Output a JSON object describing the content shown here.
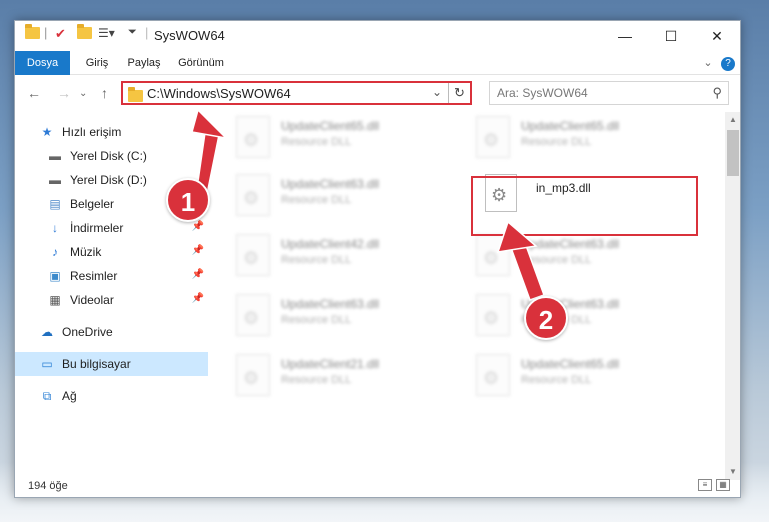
{
  "window": {
    "title": "SysWOW64",
    "minimize_glyph": "—",
    "maximize_glyph": "☐",
    "close_glyph": "✕"
  },
  "ribbon": {
    "tabs": [
      "Dosya",
      "Giriş",
      "Paylaş",
      "Görünüm"
    ],
    "expand_glyph": "⌄",
    "help_glyph": "?"
  },
  "address": {
    "path": "C:\\Windows\\SysWOW64",
    "search_placeholder": "Ara: SysWOW64"
  },
  "sidebar": {
    "items": [
      {
        "label": "Hızlı erişim",
        "icon": "star-icon",
        "pinned": false
      },
      {
        "label": "Yerel Disk (C:)",
        "icon": "drive-icon",
        "pinned": false
      },
      {
        "label": "Yerel Disk (D:)",
        "icon": "drive-icon",
        "pinned": false
      },
      {
        "label": "Belgeler",
        "icon": "documents-icon",
        "pinned": true
      },
      {
        "label": "İndirmeler",
        "icon": "download-icon",
        "pinned": true
      },
      {
        "label": "Müzik",
        "icon": "music-icon",
        "pinned": true
      },
      {
        "label": "Resimler",
        "icon": "pictures-icon",
        "pinned": true
      },
      {
        "label": "Videolar",
        "icon": "videos-icon",
        "pinned": true
      },
      {
        "label": "OneDrive",
        "icon": "cloud-icon",
        "pinned": false
      },
      {
        "label": "Bu bilgisayar",
        "icon": "computer-icon",
        "pinned": false
      },
      {
        "label": "Ağ",
        "icon": "network-icon",
        "pinned": false
      }
    ]
  },
  "files": [
    {
      "name": "UpdateClient65.dll",
      "desc": "Resource DLL"
    },
    {
      "name": "UpdateClient65.dll",
      "desc": "Resource DLL"
    },
    {
      "name": "UpdateClient63.dll",
      "desc": "Resource DLL"
    },
    {
      "name": "in_mp3.dll",
      "desc": ""
    },
    {
      "name": "UpdateClient42.dll",
      "desc": "Resource DLL"
    },
    {
      "name": "UpdateClient63.dll",
      "desc": "Resource DLL"
    },
    {
      "name": "UpdateClient63.dll",
      "desc": "Resource DLL"
    },
    {
      "name": "UpdateClient63.dll",
      "desc": "Resource DLL"
    },
    {
      "name": "UpdateClient21.dll",
      "desc": "Resource DLL"
    },
    {
      "name": "UpdateClient65.dll",
      "desc": "Resource DLL"
    }
  ],
  "status": {
    "item_count": "194 öğe"
  },
  "annotations": {
    "step1": "1",
    "step2": "2",
    "color": "#d9313b"
  }
}
